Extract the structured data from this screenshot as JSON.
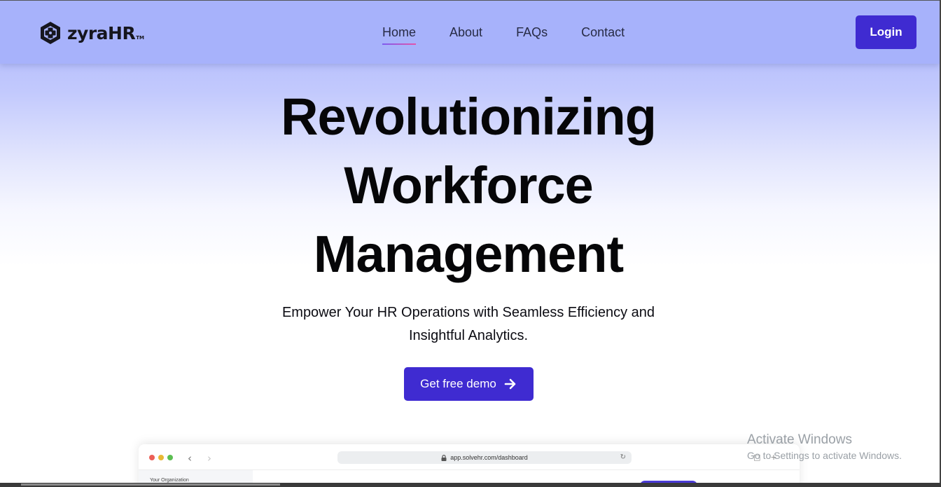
{
  "brand": {
    "name": "zyraHR",
    "trademark": "TM"
  },
  "nav": {
    "items": [
      {
        "label": "Home",
        "active": true
      },
      {
        "label": "About",
        "active": false
      },
      {
        "label": "FAQs",
        "active": false
      },
      {
        "label": "Contact",
        "active": false
      }
    ],
    "login_label": "Login"
  },
  "hero": {
    "title_lines": [
      "Revolutionizing",
      "Workforce",
      "Management"
    ],
    "subtitle_lines": [
      "Empower Your HR Operations with Seamless Efficiency and",
      "Insightful Analytics."
    ],
    "cta_label": "Get free demo"
  },
  "mockup": {
    "url": "app.solvehr.com/dashboard",
    "sidebar_heading": "Your Organization"
  },
  "watermark": {
    "title": "Activate Windows",
    "subtitle": "Go to Settings to activate Windows."
  },
  "colors": {
    "primary": "#3f2bd1",
    "header_bg": "#a7b2fb",
    "active_underline_start": "#7d5cf0",
    "active_underline_end": "#e553a9",
    "text_dark": "#060608"
  },
  "icons": {
    "logo": "hexagon-plus-logo-icon",
    "cta": "arrow-right-icon",
    "url_lock": "lock-icon",
    "reload": "reload-icon"
  }
}
